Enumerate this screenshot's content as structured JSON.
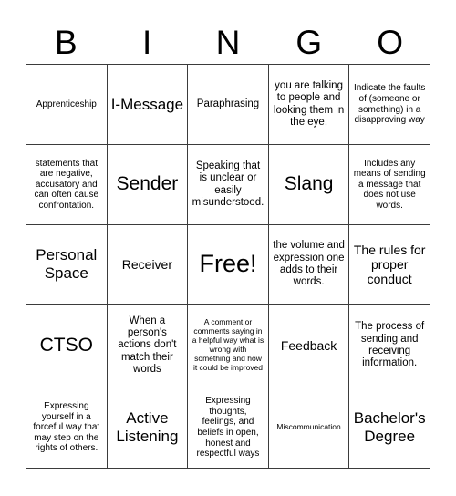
{
  "card": {
    "header_letters": [
      "B",
      "I",
      "N",
      "G",
      "O"
    ],
    "rows": [
      [
        {
          "text": "Apprenticeship",
          "size": "sm"
        },
        {
          "text": "I-Message",
          "size": "xl"
        },
        {
          "text": "Paraphrasing",
          "size": "md"
        },
        {
          "text": "you are talking to people and looking them in the eye,",
          "size": "md"
        },
        {
          "text": "Indicate the faults of (someone or something) in a disapproving way",
          "size": "sm"
        }
      ],
      [
        {
          "text": "statements that are negative, accusatory and can often cause confrontation.",
          "size": "sm"
        },
        {
          "text": "Sender",
          "size": "xxl"
        },
        {
          "text": "Speaking that is unclear or easily misunderstood.",
          "size": "md"
        },
        {
          "text": "Slang",
          "size": "xxl"
        },
        {
          "text": "Includes any means of sending a message that does not use words.",
          "size": "sm"
        }
      ],
      [
        {
          "text": "Personal Space",
          "size": "xl"
        },
        {
          "text": "Receiver",
          "size": "lg"
        },
        {
          "text": "Free!",
          "size": "free"
        },
        {
          "text": "the volume and expression one adds to their words.",
          "size": "md"
        },
        {
          "text": "The rules for proper conduct",
          "size": "lg"
        }
      ],
      [
        {
          "text": "CTSO",
          "size": "xxl"
        },
        {
          "text": "When a person's actions don't match their words",
          "size": "md"
        },
        {
          "text": "A comment or comments saying in a helpful way what is wrong with something and how it could be improved",
          "size": "xs"
        },
        {
          "text": "Feedback",
          "size": "lg"
        },
        {
          "text": "The process of sending and receiving information.",
          "size": "md"
        }
      ],
      [
        {
          "text": "Expressing yourself in a forceful way that may step on the rights of others.",
          "size": "sm"
        },
        {
          "text": "Active Listening",
          "size": "xl"
        },
        {
          "text": "Expressing thoughts, feelings, and beliefs in open, honest and respectful ways",
          "size": "sm"
        },
        {
          "text": "Miscommunication",
          "size": "xs"
        },
        {
          "text": "Bachelor's Degree",
          "size": "xl"
        }
      ]
    ]
  },
  "colors": {
    "background": "#ffffff",
    "text": "#000000",
    "grid_line": "#3b3b3b"
  }
}
